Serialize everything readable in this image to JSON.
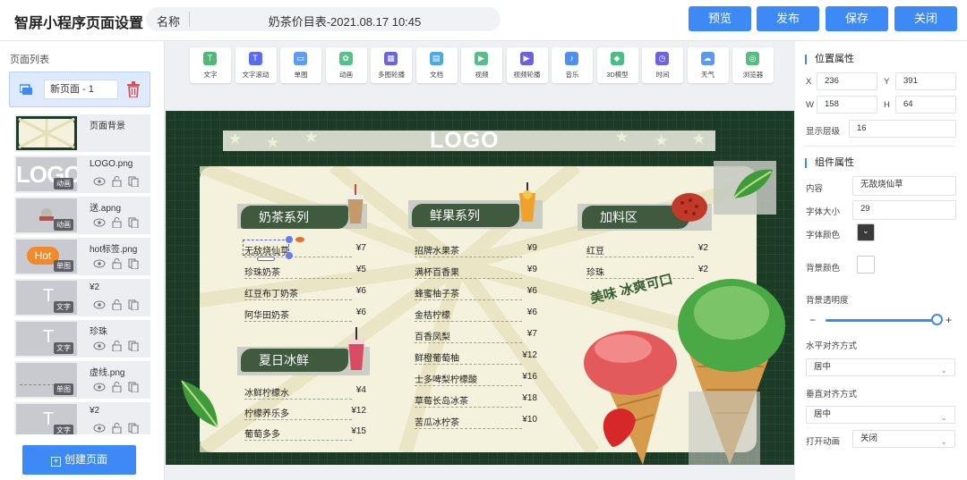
{
  "header": {
    "title": "智屏小程序页面设置",
    "name_label": "名称",
    "name_value": "奶茶价目表-2021.08.17 10:45",
    "buttons": {
      "preview": "预览",
      "publish": "发布",
      "save": "保存",
      "close": "关闭"
    }
  },
  "left": {
    "heading": "页面列表",
    "page_name": "新页面 - 1",
    "create_label": "创建页面",
    "layers": [
      {
        "name": "页面背景",
        "badge": ""
      },
      {
        "name": "LOGO.png",
        "badge": "动画"
      },
      {
        "name": "送.apng",
        "badge": "动画"
      },
      {
        "name": "hot标签.png",
        "badge": "单图"
      },
      {
        "name": "¥2",
        "badge": "文字"
      },
      {
        "name": "珍珠",
        "badge": "文字"
      },
      {
        "name": "虚线.png",
        "badge": "单图"
      },
      {
        "name": "¥2",
        "badge": "文字"
      }
    ],
    "thumb_texts": {
      "logo": "LOGO",
      "hot": "Hot",
      "text": "T"
    }
  },
  "toolbar": [
    {
      "label": "文字",
      "color": "#4fb873",
      "icon": "text-icon"
    },
    {
      "label": "文字滚动",
      "color": "#5b6cf0",
      "icon": "text-scroll-icon"
    },
    {
      "label": "单图",
      "color": "#5c9cf2",
      "icon": "image-icon"
    },
    {
      "label": "动画",
      "color": "#54c08a",
      "icon": "animation-icon"
    },
    {
      "label": "多图轮播",
      "color": "#6a63e6",
      "icon": "carousel-icon"
    },
    {
      "label": "文档",
      "color": "#4aa9e8",
      "icon": "document-icon"
    },
    {
      "label": "视频",
      "color": "#57be8b",
      "icon": "video-icon"
    },
    {
      "label": "视频轮播",
      "color": "#6e5fe3",
      "icon": "video-carousel-icon"
    },
    {
      "label": "音乐",
      "color": "#4f8ff0",
      "icon": "music-icon"
    },
    {
      "label": "3D模型",
      "color": "#4bbd84",
      "icon": "model-3d-icon"
    },
    {
      "label": "时间",
      "color": "#6b62e4",
      "icon": "clock-icon"
    },
    {
      "label": "天气",
      "color": "#5a99ef",
      "icon": "weather-icon"
    },
    {
      "label": "浏览器",
      "color": "#55bd82",
      "icon": "browser-icon"
    }
  ],
  "canvas": {
    "logo": "LOGO",
    "categories": [
      "奶茶系列",
      "鲜果系列",
      "加料区",
      "夏日冰鲜"
    ],
    "milk_tea": [
      {
        "name": "无敌烧仙草",
        "price": "¥7"
      },
      {
        "name": "珍珠奶茶",
        "price": "¥5"
      },
      {
        "name": "红豆布丁奶茶",
        "price": "¥6"
      },
      {
        "name": "阿华田奶茶",
        "price": "¥6"
      }
    ],
    "fruit": [
      {
        "name": "招牌水果茶",
        "price": "¥9"
      },
      {
        "name": "满杯百香果",
        "price": "¥9"
      },
      {
        "name": "蜂蜜柚子茶",
        "price": "¥6"
      },
      {
        "name": "金桔柠檬",
        "price": "¥6"
      },
      {
        "name": "百香凤梨",
        "price": "¥7"
      },
      {
        "name": "鲜橙葡萄柚",
        "price": "¥12"
      },
      {
        "name": "士多啤梨柠檬酸",
        "price": "¥16"
      },
      {
        "name": "草莓长岛冰茶",
        "price": "¥18"
      },
      {
        "name": "苦瓜冰柠茶",
        "price": "¥10"
      }
    ],
    "toppings": [
      {
        "name": "红豆",
        "price": "¥2"
      },
      {
        "name": "珍珠",
        "price": "¥2"
      }
    ],
    "summer": [
      {
        "name": "冰鲜柠檬水",
        "price": "¥4"
      },
      {
        "name": "柠檬养乐多",
        "price": "¥12"
      },
      {
        "name": "葡萄多多",
        "price": "¥15"
      }
    ],
    "slogan": "美味 冰爽可口"
  },
  "props": {
    "position_title": "位置属性",
    "x_label": "X",
    "x": "236",
    "y_label": "Y",
    "y": "391",
    "w_label": "W",
    "w": "158",
    "h_label": "H",
    "h": "64",
    "layer_label": "显示层级",
    "layer": "16",
    "component_title": "组件属性",
    "content_label": "内容",
    "content": "无敌烧仙草",
    "font_size_label": "字体大小",
    "font_size": "29",
    "font_color_label": "字体颜色",
    "font_color": "#3a3a3a",
    "bg_color_label": "背景颜色",
    "bg_color": "#ffffff",
    "opacity_label": "背景透明度",
    "opacity": 1.0,
    "minus": "−",
    "plus": "+",
    "h_align_label": "水平对齐方式",
    "h_align": "居中",
    "v_align_label": "垂直对齐方式",
    "v_align": "居中",
    "anim_label": "打开动画",
    "anim": "关闭"
  }
}
